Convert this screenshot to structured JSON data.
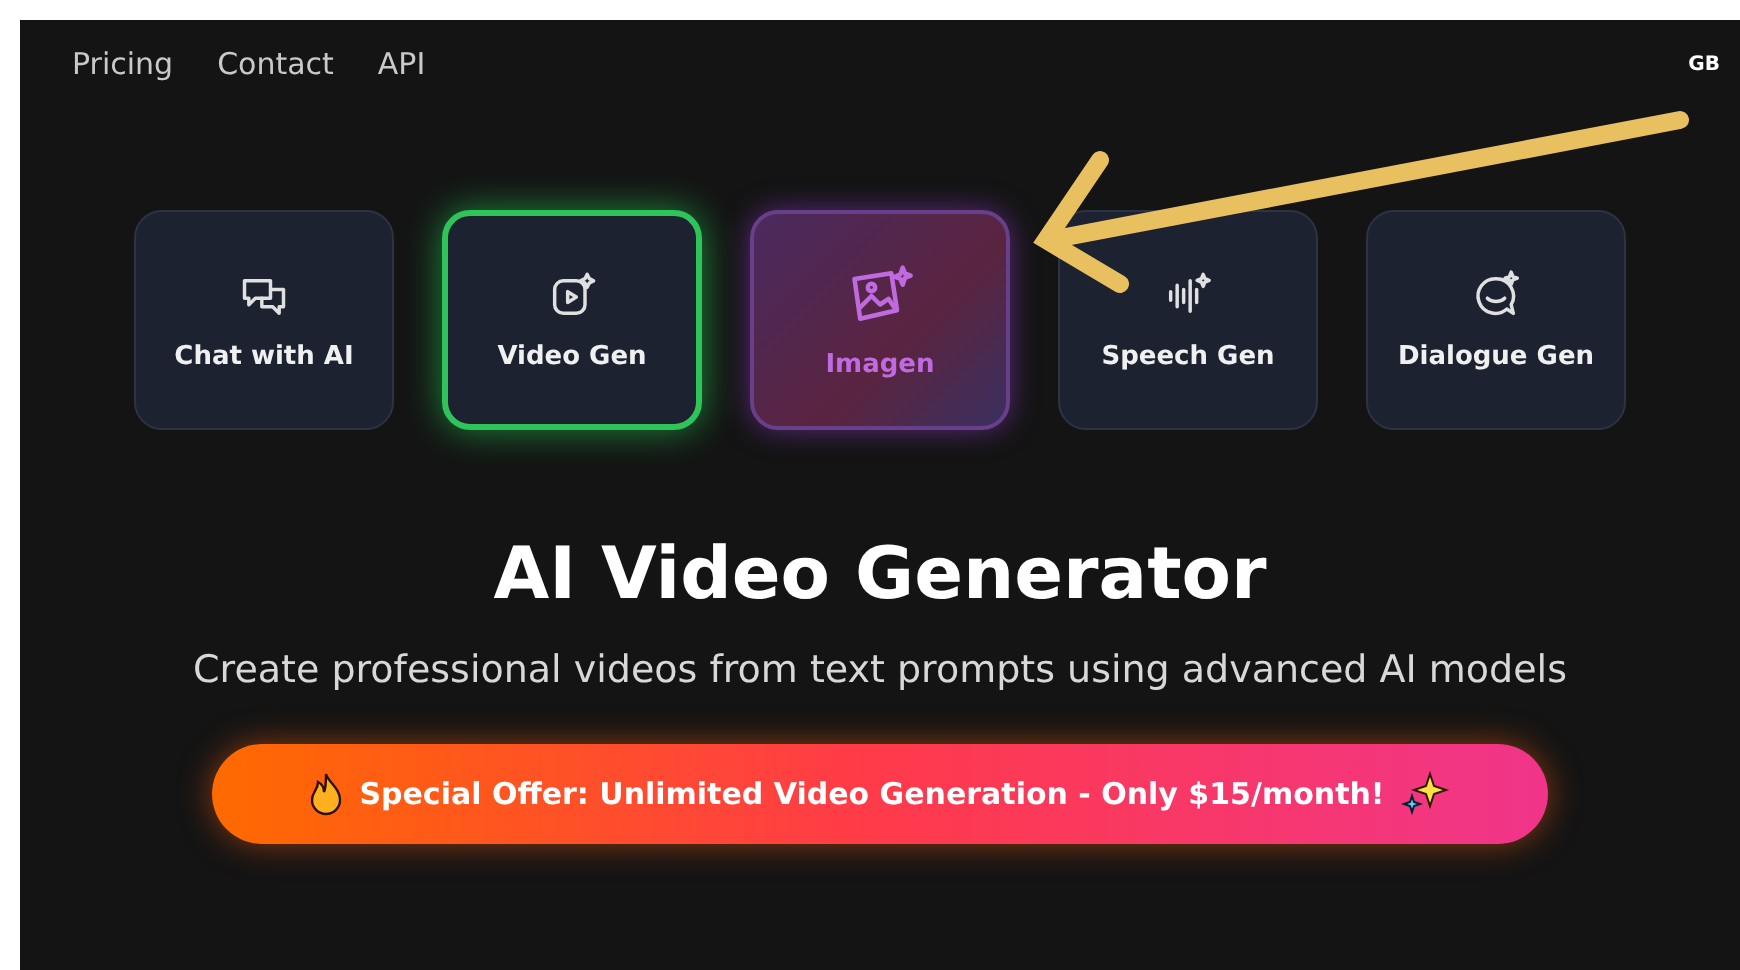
{
  "nav": {
    "links": [
      "Pricing",
      "Contact",
      "API"
    ],
    "account": "GB"
  },
  "tools": [
    {
      "label": "Chat with AI",
      "kind": "chat",
      "selected": false,
      "hovered": false
    },
    {
      "label": "Video Gen",
      "kind": "video",
      "selected": true,
      "hovered": false
    },
    {
      "label": "Imagen",
      "kind": "image",
      "selected": false,
      "hovered": true
    },
    {
      "label": "Speech Gen",
      "kind": "speech",
      "selected": false,
      "hovered": false
    },
    {
      "label": "Dialogue Gen",
      "kind": "dialogue",
      "selected": false,
      "hovered": false
    }
  ],
  "hero": {
    "title": "AI Video Generator",
    "subtitle": "Create professional videos from text prompts using advanced AI models"
  },
  "offer": {
    "text": "Special Offer: Unlimited Video Generation - Only $15/month!"
  }
}
